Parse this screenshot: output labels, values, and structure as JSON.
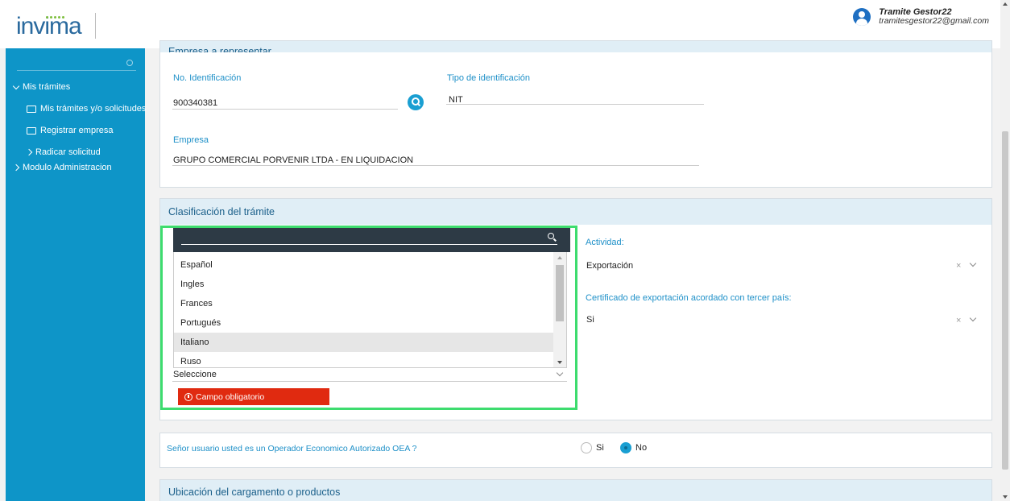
{
  "header": {
    "logo_text": "invima",
    "user_name": "Tramite Gestor22",
    "user_email": "tramitesgestor22@gmail.com"
  },
  "sidebar": {
    "items": [
      {
        "label": "Mis trámites",
        "icon": "chevron-down-icon"
      },
      {
        "label": "Mis trámites y/o solicitudes",
        "icon": "folder-icon"
      },
      {
        "label": "Registrar empresa",
        "icon": "folder-icon"
      },
      {
        "label": "Radicar solicitud",
        "icon": "chevron-right-icon"
      },
      {
        "label": "Modulo Administracion",
        "icon": "chevron-right-icon"
      }
    ]
  },
  "empresa_section": {
    "header_partial": "Empresa a representar",
    "id_label": "No. Identificación",
    "id_value": "900340381",
    "tipo_label": "Tipo de identificación",
    "tipo_value": "NIT",
    "empresa_label": "Empresa",
    "empresa_value": "GRUPO COMERCIAL PORVENIR LTDA - EN LIQUIDACION"
  },
  "clasificacion": {
    "title": "Clasificación del trámite",
    "dropdown_options": [
      "Español",
      "Ingles",
      "Frances",
      "Portugués",
      "Italiano",
      "Ruso"
    ],
    "hovered_option": "Italiano",
    "select_value": "Seleccione",
    "error_text": "Campo obligatorio",
    "actividad_label": "Actividad:",
    "actividad_value": "Exportación",
    "cert_label": "Certificado de exportación acordado con tercer país:",
    "cert_value": "Si",
    "clear_symbol": "×"
  },
  "oea": {
    "question": "Señor usuario usted es un Operador Economico Autorizado OEA ?",
    "option_yes": "Si",
    "option_no": "No",
    "selected": "No"
  },
  "ubicacion": {
    "title": "Ubicación del cargamento o productos"
  },
  "colors": {
    "sidebar_bg": "#0e95c8",
    "accent": "#1e90c8",
    "error": "#e02a10",
    "highlight": "#3ddc6e"
  }
}
